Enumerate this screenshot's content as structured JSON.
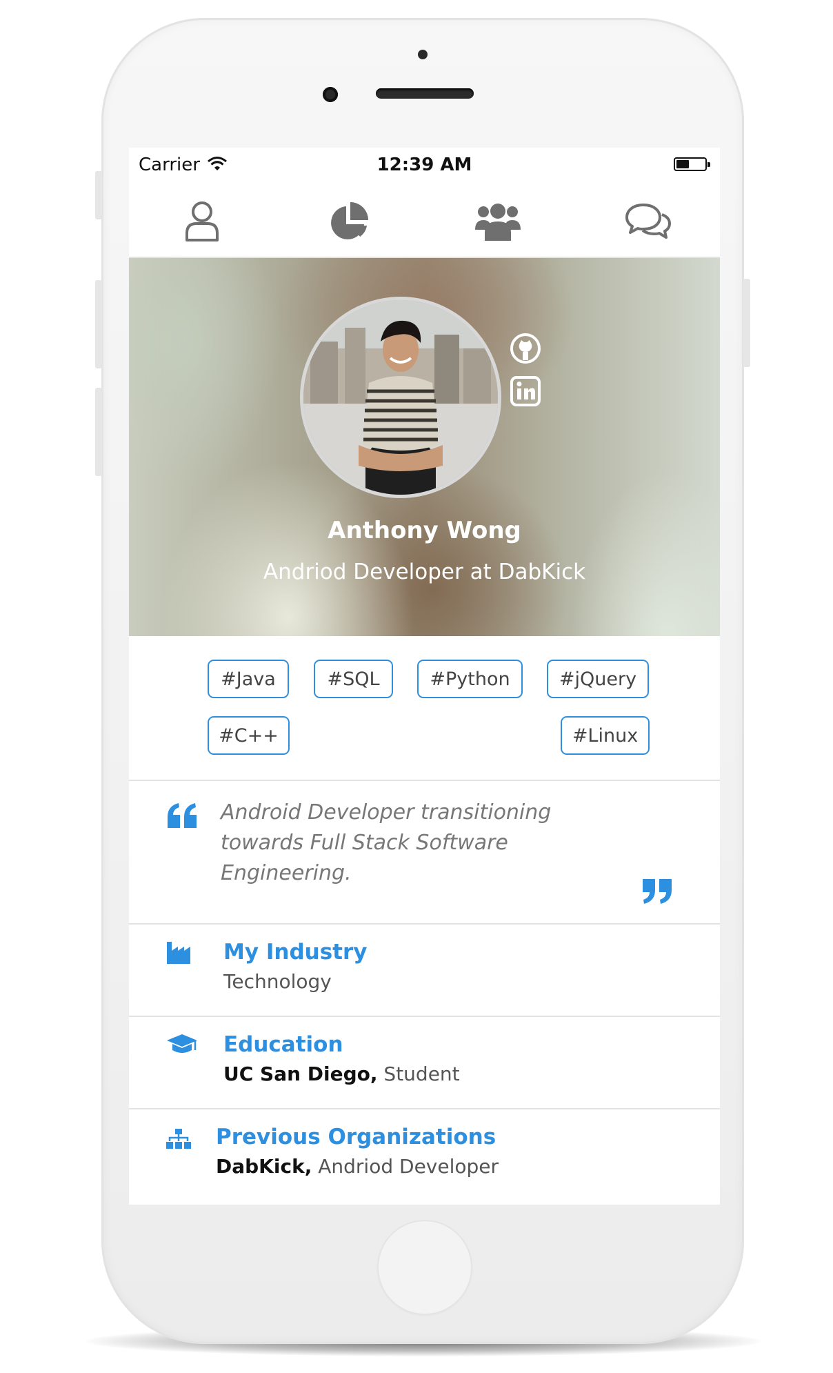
{
  "status_bar": {
    "carrier": "Carrier",
    "time": "12:39 AM"
  },
  "tabs": [
    {
      "icon": "user-icon"
    },
    {
      "icon": "pie-chart-icon"
    },
    {
      "icon": "users-group-icon"
    },
    {
      "icon": "comments-icon"
    }
  ],
  "profile": {
    "name": "Anthony Wong",
    "role": "Andriod Developer at DabKick",
    "social": [
      "github-icon",
      "linkedin-icon"
    ]
  },
  "tags": [
    "#Java",
    "#SQL",
    "#Python",
    "#jQuery",
    "#C++",
    "#Linux"
  ],
  "quote": "Android Developer transitioning towards Full Stack Software Engineering.",
  "sections": {
    "industry": {
      "title": "My Industry",
      "value": "Technology"
    },
    "education": {
      "title": "Education",
      "bold": "UC San Diego,",
      "value": " Student"
    },
    "organizations": {
      "title": "Previous Organizations",
      "bold": "DabKick,",
      "value": " Andriod Developer"
    }
  },
  "colors": {
    "accent": "#2d8fdf",
    "icon_gray": "#6f6f6f"
  }
}
